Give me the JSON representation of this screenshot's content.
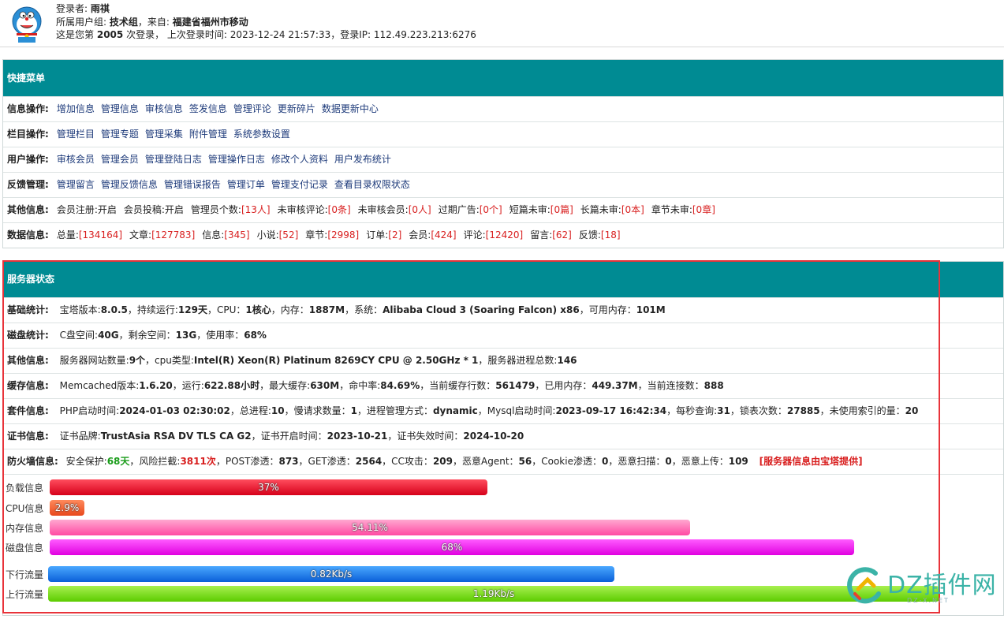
{
  "header": {
    "user_label": "登录者:",
    "user": "雨祺",
    "group_label": "所属用户组:",
    "group": "技术组",
    "from_label": "，来自:",
    "from": "福建省福州市移动",
    "login_prefix": "这是您第",
    "login_count": "2005",
    "login_mid": "次登录，",
    "last_login_label": "上次登录时间:",
    "last_login": "2023-12-24 21:57:33，",
    "ip_label": "登录IP:",
    "ip": "112.49.223.213:6276"
  },
  "quick_menu": {
    "title": "快捷菜单",
    "rows": [
      {
        "label": "信息操作:",
        "links": [
          "增加信息",
          "管理信息",
          "审核信息",
          "签发信息",
          "管理评论",
          "更新碎片",
          "数据更新中心"
        ]
      },
      {
        "label": "栏目操作:",
        "links": [
          "管理栏目",
          "管理专题",
          "管理采集",
          "附件管理",
          "系统参数设置"
        ]
      },
      {
        "label": "用户操作:",
        "links": [
          "审核会员",
          "管理会员",
          "管理登陆日志",
          "管理操作日志",
          "修改个人资料",
          "用户发布统计"
        ]
      },
      {
        "label": "反馈管理:",
        "links": [
          "管理留言",
          "管理反馈信息",
          "管理错误报告",
          "管理订单",
          "管理支付记录",
          "查看目录权限状态"
        ]
      }
    ],
    "other_info": {
      "label": "其他信息:",
      "items": [
        {
          "k": "会员注册:开启",
          "v": ""
        },
        {
          "k": "会员投稿:开启",
          "v": ""
        },
        {
          "k": "管理员个数:",
          "v": "[13人]"
        },
        {
          "k": "未审核评论:",
          "v": "[0条]"
        },
        {
          "k": "未审核会员:",
          "v": "[0人]"
        },
        {
          "k": "过期广告:",
          "v": "[0个]"
        },
        {
          "k": "短篇未审:",
          "v": "[0篇]"
        },
        {
          "k": "长篇未审:",
          "v": "[0本]"
        },
        {
          "k": "章节未审:",
          "v": "[0章]"
        }
      ]
    },
    "data_info": {
      "label": "数据信息:",
      "items": [
        {
          "k": "总量:",
          "v": "[134164]"
        },
        {
          "k": "文章:",
          "v": "[127783]"
        },
        {
          "k": "信息:",
          "v": "[345]"
        },
        {
          "k": "小说:",
          "v": "[52]"
        },
        {
          "k": "章节:",
          "v": "[2998]"
        },
        {
          "k": "订单:",
          "v": "[2]"
        },
        {
          "k": "会员:",
          "v": "[424]"
        },
        {
          "k": "评论:",
          "v": "[12420]"
        },
        {
          "k": "留言:",
          "v": "[62]"
        },
        {
          "k": "反馈:",
          "v": "[18]"
        }
      ]
    }
  },
  "server": {
    "title": "服务器状态",
    "basic": {
      "label": "基础统计:",
      "t1": "宝塔版本:",
      "v1": "8.0.5",
      "t2": "，持续运行:",
      "v2": "129天",
      "t3": "，CPU：",
      "v3": "1核心",
      "t4": "，内存：",
      "v4": "1887M",
      "t5": "，系统：",
      "v5": "Alibaba Cloud 3 (Soaring Falcon) x86",
      "t6": "，可用内存：",
      "v6": "101M"
    },
    "disk": {
      "label": "磁盘统计:",
      "t1": "C盘空间:",
      "v1": "40G",
      "t2": "，剩余空间：",
      "v2": "13G",
      "t3": "，使用率：",
      "v3": "68%"
    },
    "other": {
      "label": "其他信息:",
      "t1": "服务器网站数量:",
      "v1": "9个",
      "t2": "，cpu类型:",
      "v2": "Intel(R) Xeon(R) Platinum 8269CY CPU @ 2.50GHz * 1",
      "t3": "，服务器进程总数:",
      "v3": "146"
    },
    "cache": {
      "label": "缓存信息:",
      "t1": "Memcached版本:",
      "v1": "1.6.20",
      "t2": "，运行:",
      "v2": "622.88小时",
      "t3": "，最大缓存:",
      "v3": "630M",
      "t4": "，命中率:",
      "v4": "84.69%",
      "t5": "，当前缓存行数：",
      "v5": "561479",
      "t6": "，已用内存：",
      "v6": "449.37M",
      "t7": "，当前连接数：",
      "v7": "888"
    },
    "suite": {
      "label": "套件信息:",
      "t1": "PHP启动时间:",
      "v1": "2024-01-03 02:30:02",
      "t2": "，总进程:",
      "v2": "10",
      "t3": "，慢请求数量：",
      "v3": "1",
      "t4": "，进程管理方式：",
      "v4": "dynamic",
      "t5": "，Mysql启动时间:",
      "v5": "2023-09-17 16:42:34",
      "t6": "，每秒查询:",
      "v6": "31",
      "t7": "，锁表次数：",
      "v7": "27885",
      "t8": "，未使用索引的量：",
      "v8": "20"
    },
    "cert": {
      "label": "证书信息:",
      "t1": "证书品牌:",
      "v1": "TrustAsia RSA DV TLS CA G2",
      "t2": "，证书开启时间：",
      "v2": "2023-10-21",
      "t3": "，证书失效时间：",
      "v3": "2024-10-20"
    },
    "firewall": {
      "label": "防火墙信息:",
      "t1": "安全保护:",
      "v1": "68天",
      "t2": "，风险拦截:",
      "v2": "3811次",
      "t3": "，POST渗透：",
      "v3": "873",
      "t4": "，GET渗透：",
      "v4": "2564",
      "t5": "，CC攻击：",
      "v5": "209",
      "t6": "，恶意Agent：",
      "v6": "56",
      "t7": "，Cookie渗透：",
      "v7": "0",
      "t8": "，恶意扫描：",
      "v8": "0",
      "t9": "，恶意上传：",
      "v9": "109",
      "note": "[服务器信息由宝塔提供]"
    },
    "bars": [
      {
        "label": "负载信息",
        "text": "37%",
        "value": 0.37,
        "color1": "#ff4d5e",
        "color2": "#d6001a"
      },
      {
        "label": "CPU信息",
        "text": "2.9%",
        "value": 0.029,
        "color1": "#ff8a5c",
        "color2": "#e8481c"
      },
      {
        "label": "内存信息",
        "text": "54.11%",
        "value": 0.5411,
        "color1": "#ffa8d0",
        "color2": "#ff4aa3"
      },
      {
        "label": "磁盘信息",
        "text": "68%",
        "value": 0.68,
        "color1": "#ff5cff",
        "color2": "#e000e0"
      }
    ],
    "traffic": [
      {
        "label": "下行流量",
        "text": "0.82Kb/s",
        "color1": "#4aa8ff",
        "color2": "#0a5fd8"
      },
      {
        "label": "上行流量",
        "text": "1.19Kb/s",
        "color1": "#a8f050",
        "color2": "#5ccc00"
      }
    ]
  },
  "watermark": {
    "text": "DZ插件网",
    "sub": "DZ-X.NET"
  }
}
